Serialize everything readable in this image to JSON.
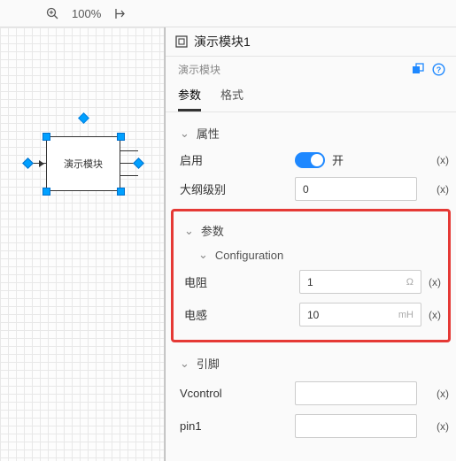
{
  "toolbar": {
    "zoom_level": "100%"
  },
  "canvas": {
    "module_label": "演示模块"
  },
  "panel": {
    "title": "演示模块1",
    "subtitle": "演示模块",
    "tabs": {
      "params": "参数",
      "format": "格式"
    },
    "sections": {
      "attributes": {
        "title": "属性",
        "enable_label": "启用",
        "enable_state": "开",
        "outline_label": "大纲级别",
        "outline_value": "0"
      },
      "params": {
        "title": "参数",
        "config_title": "Configuration",
        "resistance_label": "电阻",
        "resistance_value": "1",
        "resistance_unit": "Ω",
        "inductance_label": "电感",
        "inductance_value": "10",
        "inductance_unit": "mH"
      },
      "pins": {
        "title": "引脚",
        "vcontrol_label": "Vcontrol",
        "pin1_label": "pin1"
      }
    },
    "x_marker": "(x)"
  }
}
